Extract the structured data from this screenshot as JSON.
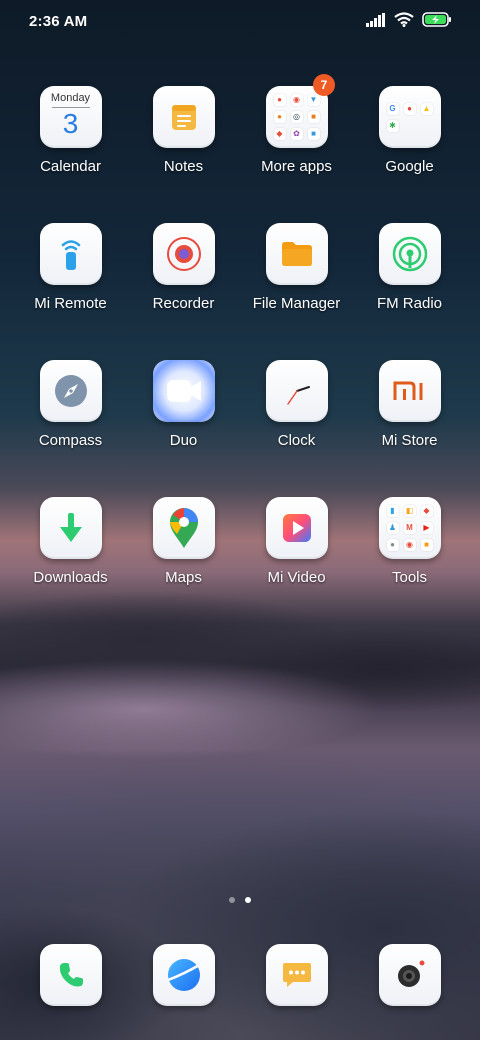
{
  "status": {
    "time": "2:36 AM",
    "icons": [
      "signal-icon",
      "wifi-icon",
      "battery-charging-icon"
    ]
  },
  "apps": {
    "calendar": {
      "label": "Calendar",
      "weekday": "Monday",
      "date": "3"
    },
    "notes": {
      "label": "Notes"
    },
    "more_apps": {
      "label": "More apps",
      "badge": "7"
    },
    "google": {
      "label": "Google"
    },
    "mi_remote": {
      "label": "Mi Remote"
    },
    "recorder": {
      "label": "Recorder"
    },
    "file_manager": {
      "label": "File Manager"
    },
    "fm_radio": {
      "label": "FM Radio"
    },
    "compass": {
      "label": "Compass"
    },
    "duo": {
      "label": "Duo"
    },
    "clock": {
      "label": "Clock"
    },
    "mi_store": {
      "label": "Mi Store"
    },
    "downloads": {
      "label": "Downloads"
    },
    "maps": {
      "label": "Maps"
    },
    "mi_video": {
      "label": "Mi Video"
    },
    "tools": {
      "label": "Tools"
    }
  },
  "pages": {
    "count": 2,
    "active": 2
  },
  "dock": [
    "phone-icon",
    "browser-icon",
    "messages-icon",
    "camera-icon"
  ],
  "colors": {
    "accent_blue": "#2a7de1",
    "green": "#2ecc71",
    "orange": "#f39c12",
    "badge": "#f05a24",
    "mi_orange": "#e05a1a"
  }
}
